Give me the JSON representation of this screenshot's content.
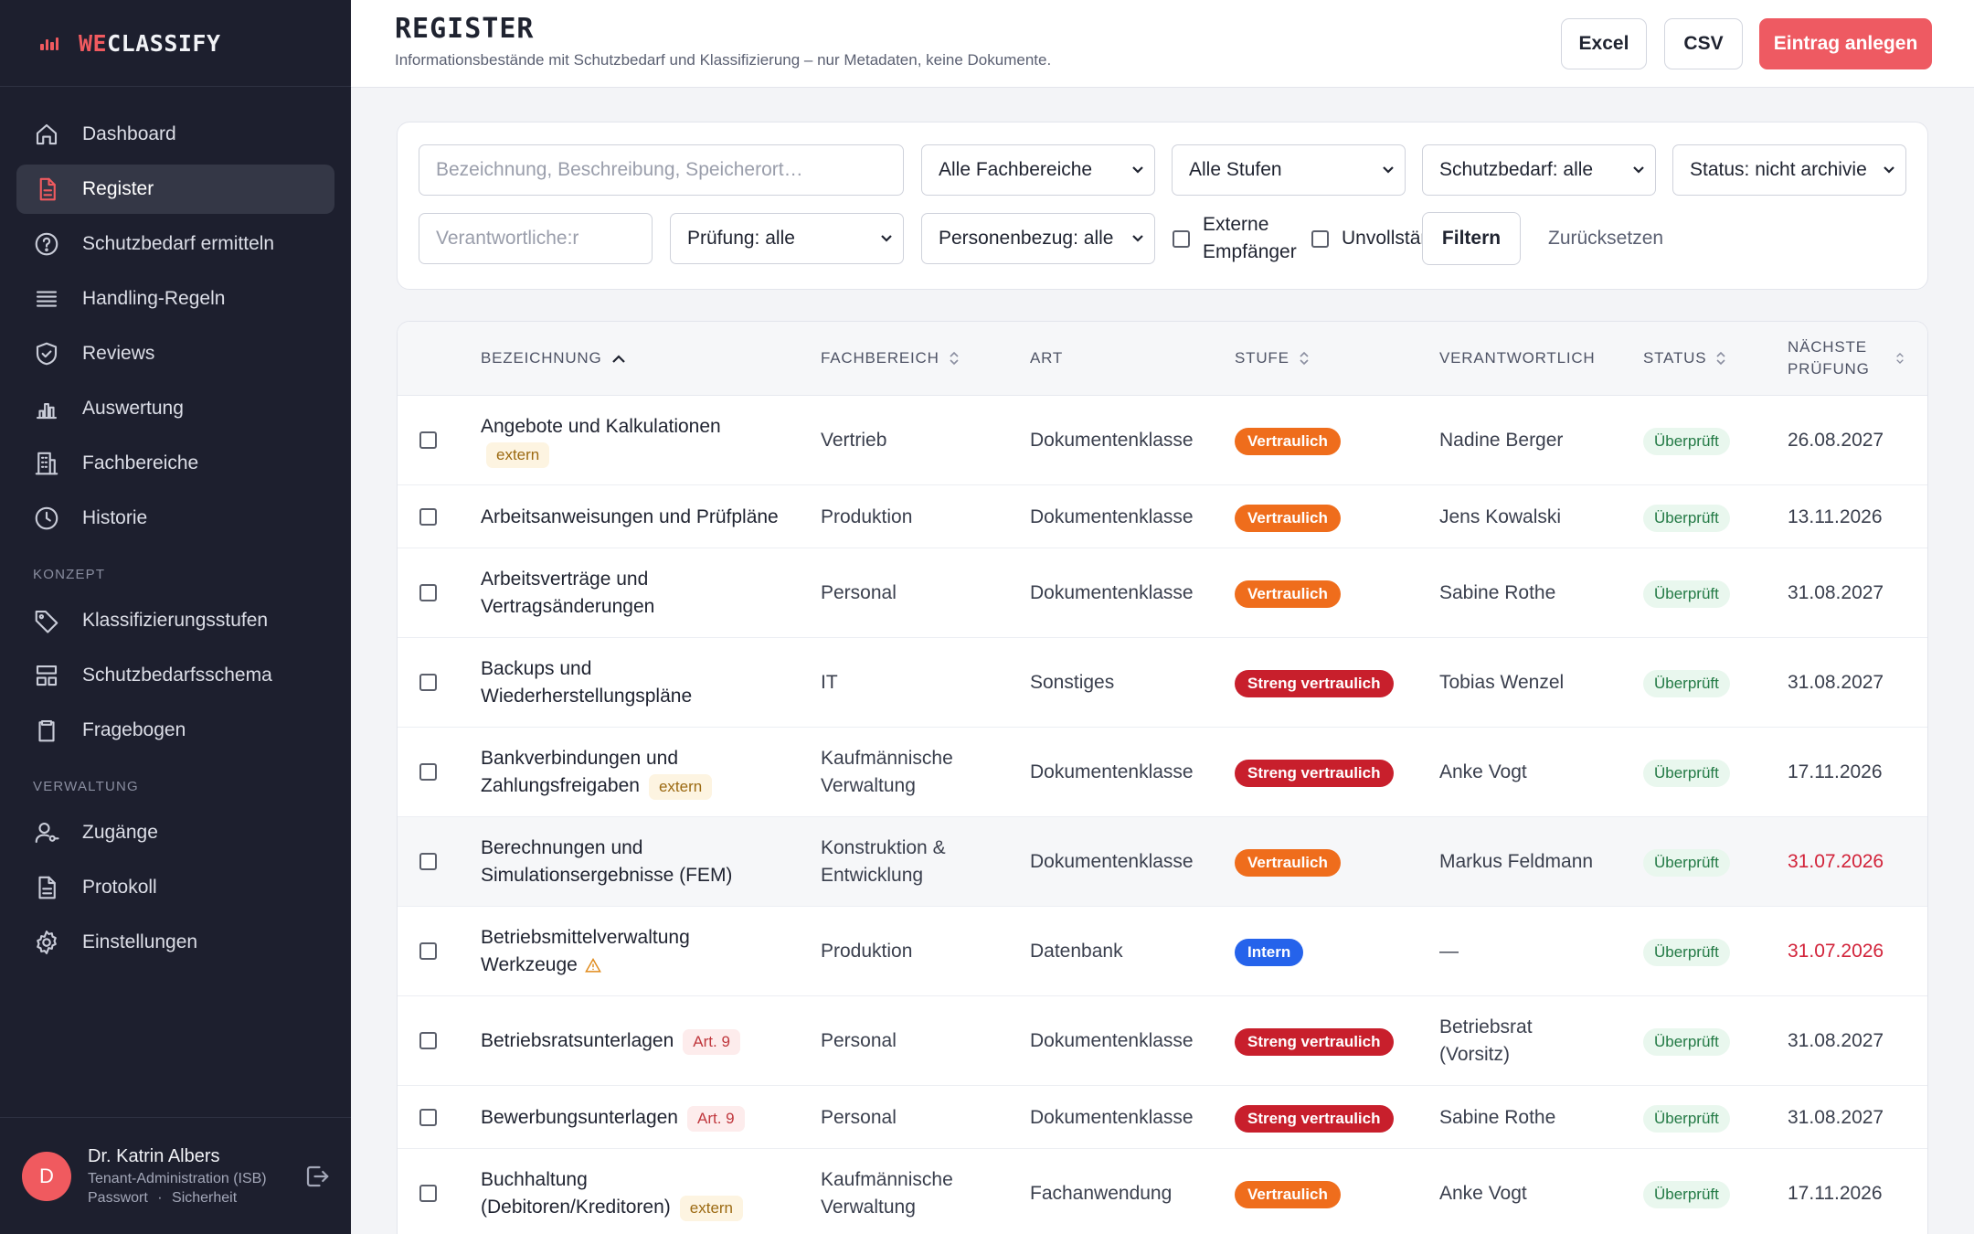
{
  "app": {
    "brand_prefix": "WE",
    "brand_suffix": "CLASSIFY"
  },
  "sidebar": {
    "items": [
      {
        "label": "Dashboard",
        "icon": "home-icon"
      },
      {
        "label": "Register",
        "icon": "document-icon",
        "active": true
      },
      {
        "label": "Schutzbedarf ermitteln",
        "icon": "help-circle-icon"
      },
      {
        "label": "Handling-Regeln",
        "icon": "list-icon"
      },
      {
        "label": "Reviews",
        "icon": "shield-check-icon"
      },
      {
        "label": "Auswertung",
        "icon": "bar-chart-icon"
      },
      {
        "label": "Fachbereiche",
        "icon": "building-icon"
      },
      {
        "label": "Historie",
        "icon": "clock-icon"
      }
    ],
    "section_konzept": "KONZEPT",
    "konzept_items": [
      {
        "label": "Klassifizierungsstufen",
        "icon": "tag-icon"
      },
      {
        "label": "Schutzbedarfsschema",
        "icon": "layout-icon"
      },
      {
        "label": "Fragebogen",
        "icon": "clipboard-icon"
      }
    ],
    "section_verwaltung": "VERWALTUNG",
    "verwaltung_items": [
      {
        "label": "Zugänge",
        "icon": "user-key-icon"
      },
      {
        "label": "Protokoll",
        "icon": "file-text-icon"
      },
      {
        "label": "Einstellungen",
        "icon": "gear-icon"
      }
    ],
    "user": {
      "initial": "D",
      "name": "Dr. Katrin Albers",
      "role": "Tenant-Administration (ISB)",
      "link_password": "Passwort",
      "separator": "·",
      "link_security": "Sicherheit"
    }
  },
  "header": {
    "title": "REGISTER",
    "subtitle": "Informationsbestände mit Schutzbedarf und Klassifizierung – nur Metadaten, keine Dokumente.",
    "btn_excel": "Excel",
    "btn_csv": "CSV",
    "btn_create": "Eintrag anlegen"
  },
  "filters": {
    "search_placeholder": "Bezeichnung, Beschreibung, Speicherort…",
    "fachbereich": "Alle Fachbereiche",
    "stufe": "Alle Stufen",
    "schutzbedarf": "Schutzbedarf: alle",
    "status": "Status: nicht archivie",
    "verantwortlich_placeholder": "Verantwortliche:r",
    "pruefung": "Prüfung: alle",
    "personenbezug": "Personenbezug: alle",
    "externe_label_1": "Externe",
    "externe_label_2": "Empfänger",
    "unvollstaendig_label": "Unvollstär",
    "btn_filter": "Filtern",
    "btn_reset": "Zurücksetzen"
  },
  "table": {
    "columns": {
      "bezeichnung": "BEZEICHNUNG",
      "fachbereich": "FACHBEREICH",
      "art": "ART",
      "stufe": "STUFE",
      "verantwortlich": "VERANTWORTLICH",
      "status": "STATUS",
      "naechste_1": "NÄCHSTE",
      "naechste_2": "PRÜFUNG"
    },
    "rows": [
      {
        "name": [
          "Angebote und Kalkulationen"
        ],
        "tag": "extern",
        "tag_line": 2,
        "fachbereich": [
          "Vertrieb"
        ],
        "art": "Dokumentenklasse",
        "stufe": "Vertraulich",
        "stufe_type": "vertraulich",
        "verantwortlich": [
          "Nadine Berger"
        ],
        "status": "Überprüft",
        "date": "26.08.2027",
        "overdue": false
      },
      {
        "name": [
          "Arbeitsanweisungen und Prüfpläne"
        ],
        "fachbereich": [
          "Produktion"
        ],
        "art": "Dokumentenklasse",
        "stufe": "Vertraulich",
        "stufe_type": "vertraulich",
        "verantwortlich": [
          "Jens Kowalski"
        ],
        "status": "Überprüft",
        "date": "13.11.2026",
        "overdue": false
      },
      {
        "name": [
          "Arbeitsverträge und",
          "Vertragsänderungen"
        ],
        "fachbereich": [
          "Personal"
        ],
        "art": "Dokumentenklasse",
        "stufe": "Vertraulich",
        "stufe_type": "vertraulich",
        "verantwortlich": [
          "Sabine Rothe"
        ],
        "status": "Überprüft",
        "date": "31.08.2027",
        "overdue": false
      },
      {
        "name": [
          "Backups und",
          "Wiederherstellungspläne"
        ],
        "fachbereich": [
          "IT"
        ],
        "art": "Sonstiges",
        "stufe": "Streng vertraulich",
        "stufe_type": "streng",
        "verantwortlich": [
          "Tobias Wenzel"
        ],
        "status": "Überprüft",
        "date": "31.08.2027",
        "overdue": false
      },
      {
        "name": [
          "Bankverbindungen und",
          "Zahlungsfreigaben"
        ],
        "tag": "extern",
        "tag_line": 1,
        "fachbereich": [
          "Kaufmännische",
          "Verwaltung"
        ],
        "art": "Dokumentenklasse",
        "stufe": "Streng vertraulich",
        "stufe_type": "streng",
        "verantwortlich": [
          "Anke Vogt"
        ],
        "status": "Überprüft",
        "date": "17.11.2026",
        "overdue": false
      },
      {
        "name": [
          "Berechnungen und",
          "Simulationsergebnisse (FEM)"
        ],
        "fachbereich": [
          "Konstruktion &",
          "Entwicklung"
        ],
        "art": "Dokumentenklasse",
        "stufe": "Vertraulich",
        "stufe_type": "vertraulich",
        "verantwortlich": [
          "Markus Feldmann"
        ],
        "status": "Überprüft",
        "date": "31.07.2026",
        "overdue": true,
        "highlight": true
      },
      {
        "name": [
          "Betriebsmittelverwaltung",
          "Werkzeuge"
        ],
        "warn": true,
        "fachbereich": [
          "Produktion"
        ],
        "art": "Datenbank",
        "stufe": "Intern",
        "stufe_type": "intern",
        "verantwortlich": [
          "—"
        ],
        "status": "Überprüft",
        "date": "31.07.2026",
        "overdue": true
      },
      {
        "name": [
          "Betriebsratsunterlagen"
        ],
        "tag": "Art. 9",
        "tag_type": "art9",
        "tag_line": 0,
        "fachbereich": [
          "Personal"
        ],
        "art": "Dokumentenklasse",
        "stufe": "Streng vertraulich",
        "stufe_type": "streng",
        "verantwortlich": [
          "Betriebsrat",
          "(Vorsitz)"
        ],
        "status": "Überprüft",
        "date": "31.08.2027",
        "overdue": false
      },
      {
        "name": [
          "Bewerbungsunterlagen"
        ],
        "tag": "Art. 9",
        "tag_type": "art9",
        "tag_line": 0,
        "fachbereich": [
          "Personal"
        ],
        "art": "Dokumentenklasse",
        "stufe": "Streng vertraulich",
        "stufe_type": "streng",
        "verantwortlich": [
          "Sabine Rothe"
        ],
        "status": "Überprüft",
        "date": "31.08.2027",
        "overdue": false
      },
      {
        "name": [
          "Buchhaltung",
          "(Debitoren/Kreditoren)"
        ],
        "tag": "extern",
        "tag_line": 1,
        "fachbereich": [
          "Kaufmännische",
          "Verwaltung"
        ],
        "art": "Fachanwendung",
        "stufe": "Vertraulich",
        "stufe_type": "vertraulich",
        "verantwortlich": [
          "Anke Vogt"
        ],
        "status": "Überprüft",
        "date": "17.11.2026",
        "overdue": false
      }
    ]
  },
  "colors": {
    "accent": "#ee5a62",
    "sidebar_bg": "#1d1f2e",
    "vertraulich": "#ef6d1c",
    "streng": "#c81f2c",
    "intern": "#2563eb",
    "overdue": "#d2233a"
  }
}
